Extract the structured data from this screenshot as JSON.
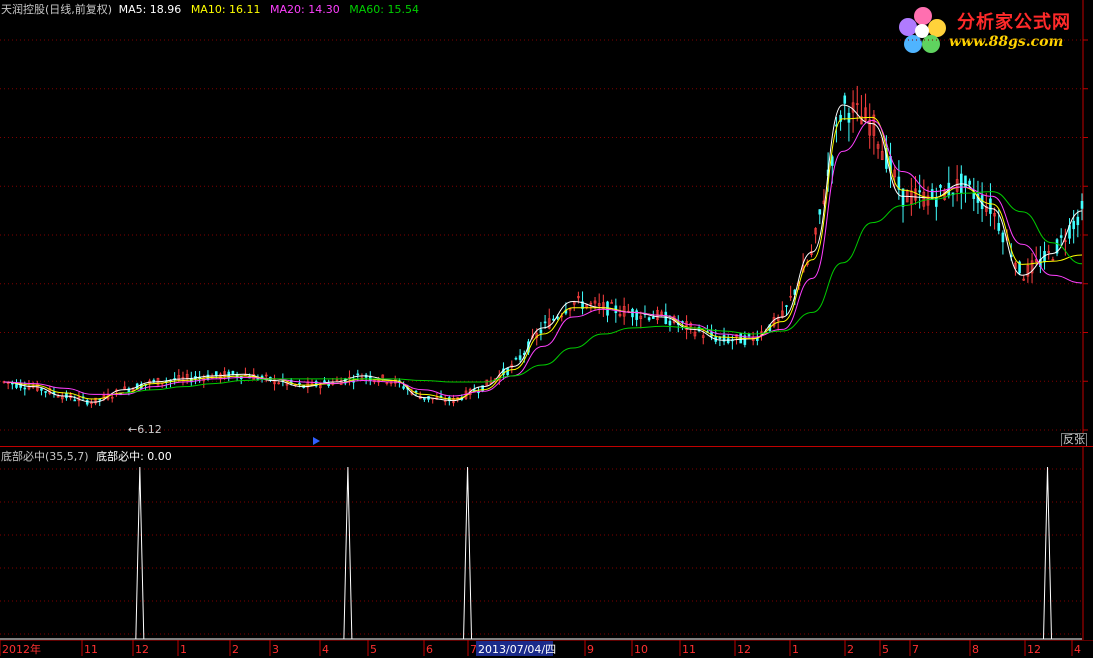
{
  "main_header": {
    "title": "天润控股(日线,前复权)",
    "ma5": "MA5: 18.96",
    "ma10": "MA10: 16.11",
    "ma20": "MA20: 14.30",
    "ma60": "MA60: 15.54"
  },
  "indicator_header": {
    "formula": "底部必中(35,5,7)",
    "value": "底部必中: 0.00"
  },
  "logo": {
    "text": "分析家公式网",
    "url": "www.88gs.com"
  },
  "low_marker": "6.12",
  "fuquan_button": "反张",
  "date_axis": {
    "labels": [
      "2012年",
      "11",
      "12",
      "1",
      "2",
      "3",
      "4",
      "5",
      "6",
      "7",
      "9",
      "10",
      "11",
      "12",
      "1",
      "2",
      "5",
      "7",
      "8",
      "12",
      "4"
    ],
    "cursor_date": "2013/07/04/四"
  },
  "colors": {
    "up": "#ff4040",
    "down": "#40ffff",
    "ma5": "#ffffff",
    "ma10": "#ffff00",
    "ma20": "#ff40ff",
    "ma60": "#00cc00",
    "grid": "#800000",
    "indicator": "#ffffff"
  },
  "chart_data": {
    "type": "line",
    "title": "天润控股(日线,前复权)",
    "series": [
      {
        "name": "MA5",
        "values": [
          7.9,
          7.6,
          7.0,
          6.6,
          7.4,
          7.9,
          8.1,
          8.3,
          8.4,
          8.0,
          7.6,
          7.9,
          8.3,
          8.0,
          6.9,
          6.7,
          7.6,
          8.9,
          11.4,
          13.1,
          12.7,
          12.4,
          12.1,
          11.3,
          10.6,
          10.7,
          12.1,
          16.3,
          25.8,
          24.6,
          19.9,
          19.8,
          20.7,
          19.1,
          14.8,
          16.2,
          18.96
        ]
      },
      {
        "name": "MA10",
        "values": [
          7.9,
          7.7,
          7.2,
          6.8,
          7.2,
          7.8,
          8.0,
          8.2,
          8.3,
          8.1,
          7.7,
          7.8,
          8.1,
          8.0,
          7.1,
          6.8,
          7.4,
          8.7,
          11.0,
          12.7,
          12.7,
          12.4,
          12.2,
          11.4,
          10.8,
          10.7,
          11.8,
          15.8,
          24.9,
          25.0,
          20.3,
          19.8,
          20.5,
          19.4,
          15.5,
          15.7,
          16.11
        ]
      },
      {
        "name": "MA20",
        "values": [
          7.9,
          7.8,
          7.5,
          7.1,
          7.1,
          7.6,
          7.9,
          8.1,
          8.2,
          8.1,
          7.9,
          7.8,
          8.0,
          7.9,
          7.4,
          7.0,
          7.3,
          8.3,
          10.2,
          12.1,
          12.6,
          12.4,
          12.2,
          11.6,
          11.0,
          10.8,
          11.3,
          14.6,
          22.8,
          24.8,
          21.5,
          20.2,
          20.5,
          19.9,
          16.8,
          14.8,
          14.3
        ]
      },
      {
        "name": "MA60",
        "values": [
          null,
          null,
          null,
          null,
          7.2,
          7.4,
          7.6,
          7.8,
          8.0,
          8.1,
          8.1,
          8.1,
          8.1,
          8.1,
          8.0,
          7.9,
          7.9,
          8.3,
          9.0,
          10.1,
          11.0,
          11.4,
          11.5,
          11.4,
          11.2,
          11.0,
          11.2,
          12.4,
          15.6,
          18.2,
          19.3,
          19.7,
          20.1,
          20.2,
          18.9,
          16.9,
          15.54
        ]
      }
    ],
    "indicator": {
      "name": "底部必中",
      "params": "(35,5,7)",
      "signal_positions": [
        0.126,
        0.319,
        0.43,
        0.968
      ],
      "value": 0
    }
  }
}
